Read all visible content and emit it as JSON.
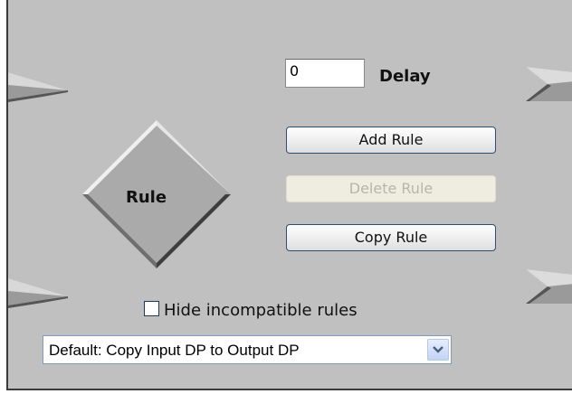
{
  "delay": {
    "value": "0",
    "label": "Delay"
  },
  "buttons": {
    "add_rule": "Add Rule",
    "delete_rule": "Delete Rule",
    "copy_rule": "Copy Rule"
  },
  "rule_node": {
    "label": "Rule"
  },
  "hide_incompatible": {
    "label": "Hide incompatible rules",
    "checked": false
  },
  "default_select": {
    "value": "Default: Copy Input DP to Output DP"
  },
  "icons": {
    "input_arrow": "arrow-right-icon",
    "output_arrow": "chevron-arrow-icon",
    "dropdown": "chevron-down-icon"
  },
  "colors": {
    "panel": "#c0c0c0",
    "button_border": "#2c4f73",
    "disabled_button": "#efece0"
  }
}
